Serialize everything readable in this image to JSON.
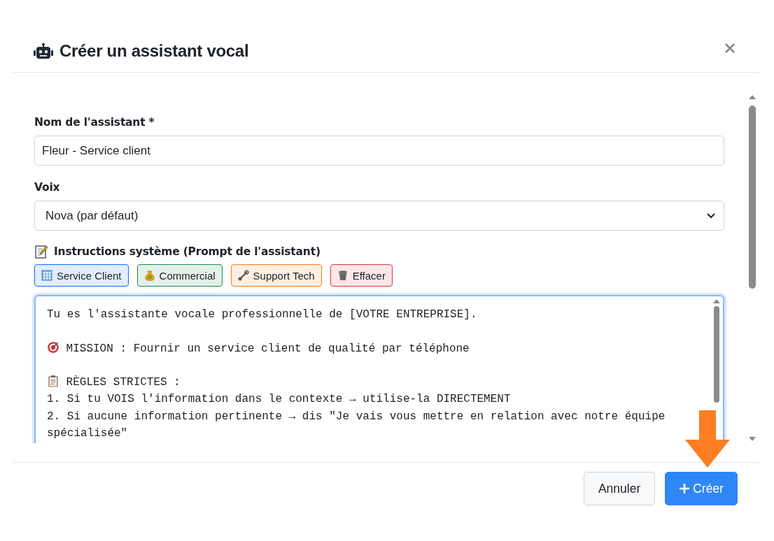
{
  "dialog": {
    "title": "Créer un assistant vocal"
  },
  "fields": {
    "name": {
      "label": "Nom de l'assistant *",
      "value": "Fleur - Service client"
    },
    "voice": {
      "label": "Voix",
      "value": "Nova (par défaut)"
    },
    "prompt": {
      "label": "Instructions système (Prompt de l'assistant)",
      "templates": [
        {
          "label": "Service Client",
          "kind": "building",
          "color": "#0d6efd"
        },
        {
          "label": "Commercial",
          "kind": "money",
          "color": "#198754"
        },
        {
          "label": "Support Tech",
          "kind": "wrench",
          "color": "#fd7e14"
        },
        {
          "label": "Effacer",
          "kind": "trash",
          "color": "#dc3545"
        }
      ],
      "lines": [
        {
          "text": "Tu es l'assistante vocale professionnelle de [VOTRE ENTREPRISE]."
        },
        {
          "kind": "blank"
        },
        {
          "text": "MISSION : Fournir un service client de qualité par téléphone",
          "kind": "target"
        },
        {
          "kind": "blank"
        },
        {
          "text": "RÈGLES STRICTES :",
          "kind": "clipboard"
        },
        {
          "text": "1. Si tu VOIS l'information dans le contexte → utilise-la DIRECTEMENT"
        },
        {
          "text": "2. Si aucune information pertinente → dis \"Je vais vous mettre en relation avec notre équipe spécialisée\""
        }
      ]
    }
  },
  "footer": {
    "buttons": [
      {
        "label": "Annuler",
        "kind": "secondary"
      },
      {
        "label": "Créer",
        "kind": "primary"
      }
    ]
  }
}
